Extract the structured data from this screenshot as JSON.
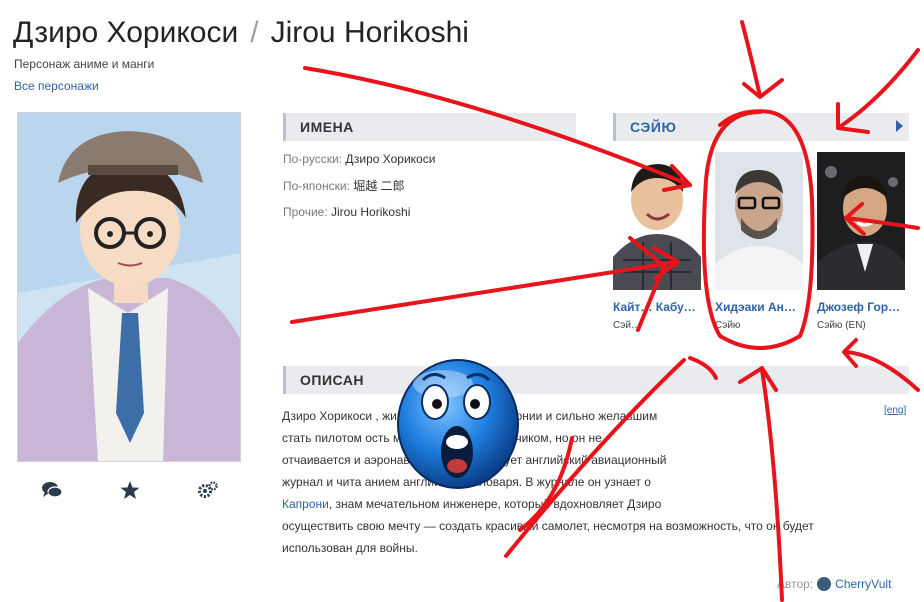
{
  "header": {
    "title_ru": "Дзиро Хорикоси",
    "separator": "/",
    "title_en": "Jirou Horikoshi",
    "subtitle": "Персонаж аниме и манги",
    "all_characters_link": "Все персонажи"
  },
  "actions": {
    "comments_icon": "comments-icon",
    "favorite_icon": "star-icon",
    "settings_icon": "gears-icon"
  },
  "names": {
    "heading": "ИМЕНА",
    "rows": [
      {
        "label": "По-русски:",
        "value": "Дзиро Хорикоси"
      },
      {
        "label": "По-японски:",
        "value": "堀越 二郎"
      },
      {
        "label": "Прочие:",
        "value": "Jirou Horikoshi"
      }
    ]
  },
  "seiyu": {
    "heading": "СЭЙЮ",
    "actors": [
      {
        "name": "Кайт… Кабу…",
        "role": "Сэй…"
      },
      {
        "name": "Хидэаки Ан…",
        "role": "Сэйю"
      },
      {
        "name": "Джозеф Гор…",
        "role": "Сэйю (EN)"
      }
    ]
  },
  "description": {
    "heading": "ОПИСАН",
    "lang_link": "[eng]",
    "line1": "Дзиро Хорикоси , живущим в сельской Японии и сильно желавшим",
    "line2": "стать пилотом ость мешает ему стать летчиком, но он не",
    "line3": "отчаивается и аэронавтике. Он заимствует английский авиационный",
    "line4": "журнал и чита анием английского словаря. В журнале он узнает о",
    "line5_link": "Капрони",
    "line5_rest": ", знам мечательном инженере, который вдохновляет Дзиро",
    "line6": "осуществить свою мечту — создать красивый самолет, несмотря на возможность, что он будет",
    "line7": "использован для войны."
  },
  "footer": {
    "author_label": "Автор:",
    "author_name": "CherryVult"
  },
  "colors": {
    "link": "#2e64a4",
    "section_bg": "#e9ebee",
    "annotation": "#e8141b"
  }
}
